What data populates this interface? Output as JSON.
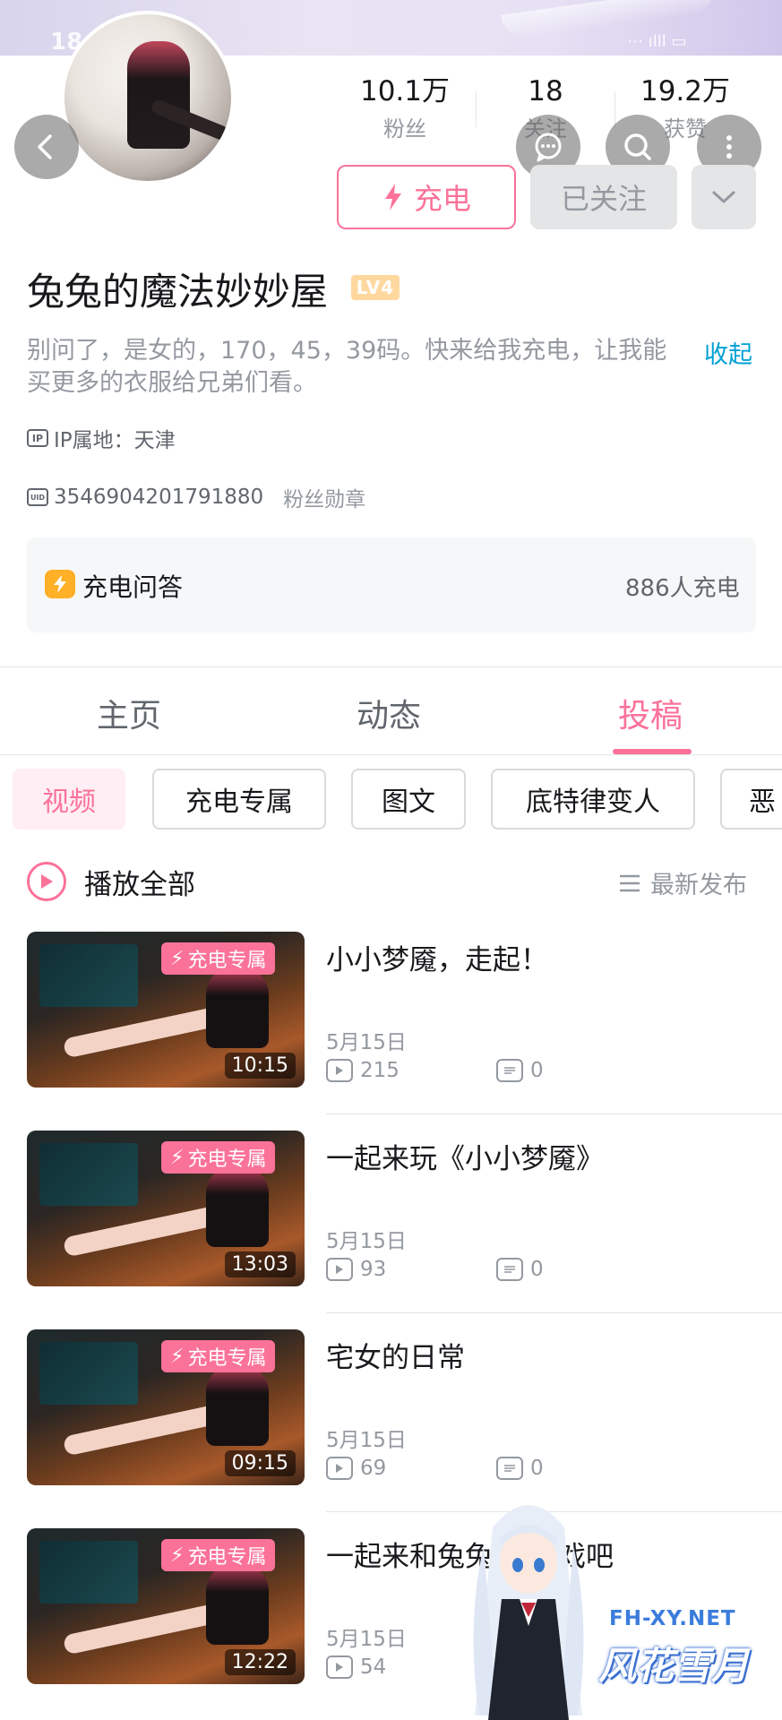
{
  "status_bar": {
    "time": "18:38",
    "right": "⋯ ılll ▭"
  },
  "header": {
    "back_icon": "back-arrow-icon",
    "actions": [
      "message-icon",
      "search-icon",
      "more-vertical-icon"
    ]
  },
  "stats": [
    {
      "value": "10.1万",
      "label": "粉丝"
    },
    {
      "value": "18",
      "label": "关注"
    },
    {
      "value": "19.2万",
      "label": "获赞"
    }
  ],
  "buttons": {
    "charge": "充电",
    "followed": "已关注"
  },
  "profile": {
    "name": "兔兔的魔法妙妙屋",
    "level": "LV4",
    "bio": "别问了，是女的，170，45，39码。快来给我充电，让我能买更多的衣服给兄弟们看。",
    "collapse": "收起",
    "ip_tag": "IP",
    "ip_location": "IP属地：天津",
    "uid_tag": "UID",
    "uid": "3546904201791880",
    "fan_medal": "粉丝勋章"
  },
  "charge_qa": {
    "label": "充电问答",
    "count": "886人充电"
  },
  "tabs": [
    {
      "label": "主页",
      "active": false
    },
    {
      "label": "动态",
      "active": false
    },
    {
      "label": "投稿",
      "active": true
    }
  ],
  "filters": [
    "视频",
    "充电专属",
    "图文",
    "底特律变人",
    "恶"
  ],
  "play_all": "播放全部",
  "sort": "最新发布",
  "videos": [
    {
      "badge": "充电专属",
      "duration": "10:15",
      "title": "小小梦魇，走起！",
      "date": "5月15日",
      "views": "215",
      "comments": "0"
    },
    {
      "badge": "充电专属",
      "duration": "13:03",
      "title": "一起来玩《小小梦魇》",
      "date": "5月15日",
      "views": "93",
      "comments": "0"
    },
    {
      "badge": "充电专属",
      "duration": "09:15",
      "title": "宅女的日常",
      "date": "5月15日",
      "views": "69",
      "comments": "0"
    },
    {
      "badge": "充电专属",
      "duration": "12:22",
      "title": "一起来和兔兔",
      "title_tail": "游戏吧",
      "date": "5月15日",
      "views": "54"
    }
  ],
  "watermark": {
    "url": "FH-XY.NET",
    "logo": "风花雪月"
  },
  "colors": {
    "accent": "#fb7299",
    "link": "#00a1d6",
    "gray_text": "#9499a0",
    "qa_icon": "#ffb027"
  }
}
